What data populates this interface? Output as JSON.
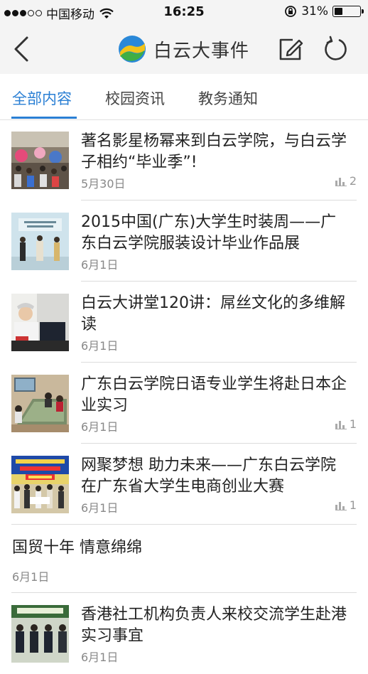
{
  "status_bar": {
    "carrier": "中国移动",
    "time": "16:25",
    "battery_percent": "31%",
    "battery_level": 0.31
  },
  "nav": {
    "title": "白云大事件",
    "logo_icon": "baiyun-logo-icon",
    "back_icon": "chevron-left-icon",
    "edit_icon": "edit-icon",
    "refresh_icon": "refresh-icon"
  },
  "tabs": [
    {
      "label": "全部内容",
      "active": true
    },
    {
      "label": "校园资讯",
      "active": false
    },
    {
      "label": "教务通知",
      "active": false
    }
  ],
  "news": [
    {
      "title": "著名影星杨幂来到白云学院，与白云学子相约“毕业季”!",
      "date": "5月30日",
      "views": "2",
      "has_thumb": true
    },
    {
      "title": "2015中国(广东)大学生时装周——广东白云学院服装设计毕业作品展",
      "date": "6月1日",
      "views": "",
      "has_thumb": true
    },
    {
      "title": "白云大讲堂120讲：屌丝文化的多维解读",
      "date": "6月1日",
      "views": "",
      "has_thumb": true
    },
    {
      "title": "广东白云学院日语专业学生将赴日本企业实习",
      "date": "6月1日",
      "views": "1",
      "has_thumb": true
    },
    {
      "title": "网聚梦想 助力未来——广东白云学院在广东省大学生电商创业大赛",
      "date": "6月1日",
      "views": "1",
      "has_thumb": true
    },
    {
      "title": "国贸十年 情意绵绵",
      "date": "6月1日",
      "views": "",
      "has_thumb": false
    },
    {
      "title": "香港社工机构负责人来校交流学生赴港实习事宜",
      "date": "6月1日",
      "views": "",
      "has_thumb": true
    }
  ],
  "colors": {
    "accent": "#2a7fd4",
    "bar_bg": "#f4f4f4"
  }
}
